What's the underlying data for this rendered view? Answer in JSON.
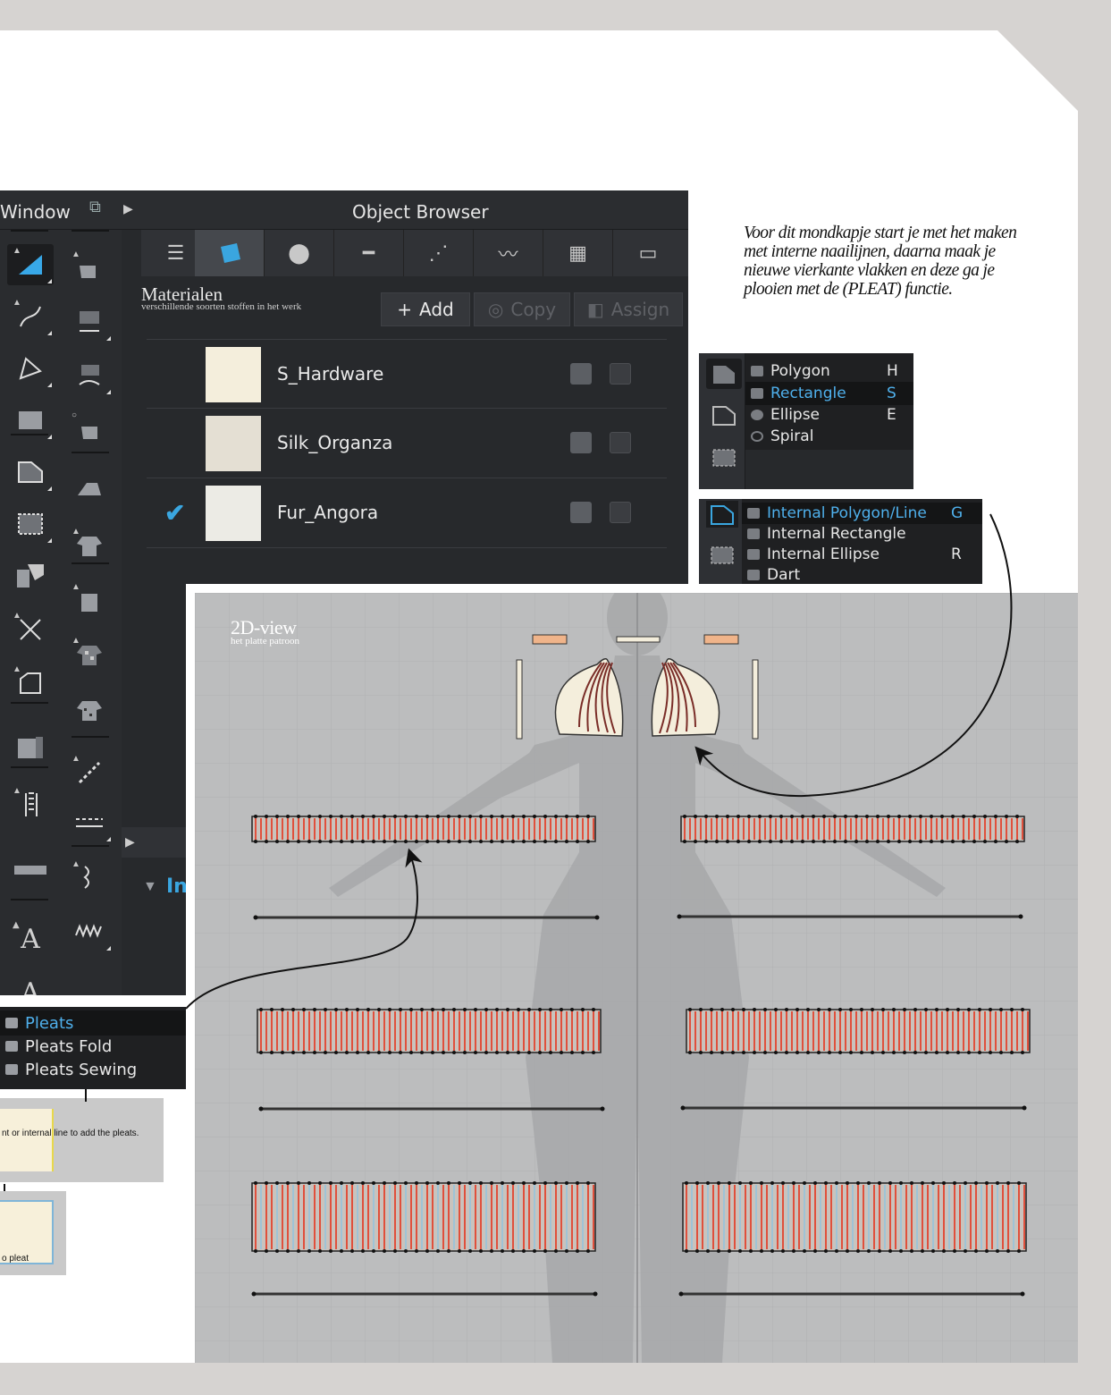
{
  "window": {
    "title_fragment": "Window",
    "panel_title": "Object Browser"
  },
  "browser_tabs": [
    {
      "icon": "list-icon"
    },
    {
      "icon": "fabric-icon"
    },
    {
      "icon": "button-icon"
    },
    {
      "icon": "buttonhole-icon"
    },
    {
      "icon": "topstitch-icon"
    },
    {
      "icon": "zipper-icon"
    },
    {
      "icon": "graphic-icon"
    },
    {
      "icon": "ruler-icon"
    }
  ],
  "materials": {
    "title": "Materialen",
    "subtitle": "verschillende soorten stoffen in het werk",
    "add_label": "Add",
    "copy_label": "Copy",
    "assign_label": "Assign",
    "items": [
      {
        "name": "S_Hardware",
        "color": "#f4eedc",
        "checked": false
      },
      {
        "name": "Silk_Organza",
        "color": "#e4dfd3",
        "checked": false
      },
      {
        "name": "Fur_Angora",
        "color": "#ecebe5",
        "checked": true
      }
    ]
  },
  "lower_panel_label": "Int",
  "note": "Voor dit mondkapje start je met het maken met interne naailijnen, daarna maak je nieuwe vierkante vlakken en deze ga je plooien met de (PLEAT) functie.",
  "shape_menu": {
    "items": [
      {
        "label": "Polygon",
        "key": "H",
        "highlight": false
      },
      {
        "label": "Rectangle",
        "key": "S",
        "highlight": true
      },
      {
        "label": "Ellipse",
        "key": "E",
        "highlight": false
      },
      {
        "label": "Spiral",
        "key": "",
        "highlight": false
      }
    ]
  },
  "internal_menu": {
    "items": [
      {
        "label": "Internal Polygon/Line",
        "key": "G",
        "highlight": true
      },
      {
        "label": "Internal Rectangle",
        "key": "",
        "highlight": false
      },
      {
        "label": "Internal Ellipse",
        "key": "R",
        "highlight": false
      },
      {
        "label": "Dart",
        "key": "",
        "highlight": false
      }
    ]
  },
  "view2d": {
    "title": "2D-view",
    "subtitle": "het platte patroon"
  },
  "pleats_menu": {
    "items": [
      {
        "label": "Pleats",
        "highlight": true
      },
      {
        "label": "Pleats Fold",
        "highlight": false
      },
      {
        "label": "Pleats Sewing",
        "highlight": false
      }
    ]
  },
  "tooltip_cards": {
    "card1": "nt or internal line to add the pleats.",
    "card2": "o pleat"
  },
  "colors": {
    "accent": "#3aa6e0",
    "pleat_red": "#e0503c",
    "pleat_blue": "#9fc3d6",
    "app_bg": "#27292c"
  }
}
